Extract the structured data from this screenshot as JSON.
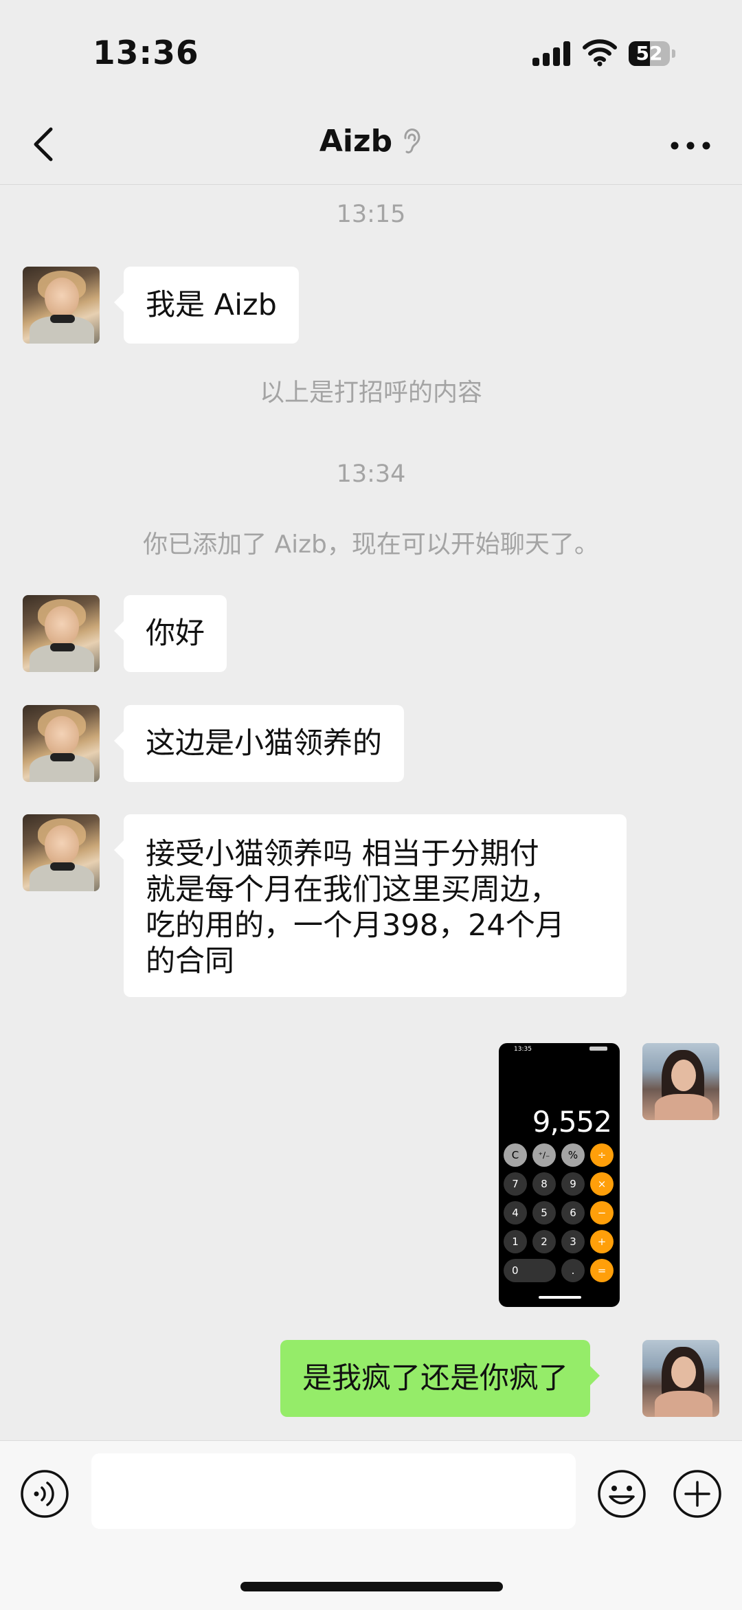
{
  "status_bar": {
    "time": "13:36",
    "battery": "52",
    "battery_level": 0.52
  },
  "header": {
    "title": "Aizb",
    "back_icon": "chevron-left-icon",
    "ear_icon": "ear-icon",
    "more_icon": "ellipsis-icon"
  },
  "messages": {
    "time1": "13:15",
    "m1": "我是 Aizb",
    "greet_note": "以上是打招呼的内容",
    "time2": "13:34",
    "added_note": "你已添加了 Aizb，现在可以开始聊天了。",
    "m2": "你好",
    "m3": "这边是小猫领养的",
    "m4_lines": [
      "接受小猫领养吗 相当于分期付",
      "就是每个月在我们这里买周边，",
      "吃的用的，一个月398，24个月",
      "的合同"
    ],
    "photo": {
      "status_time": "13:35",
      "display": "9,552",
      "keys": [
        [
          "C",
          "⁺∕₋",
          "%",
          "÷"
        ],
        [
          "7",
          "8",
          "9",
          "×"
        ],
        [
          "4",
          "5",
          "6",
          "−"
        ],
        [
          "1",
          "2",
          "3",
          "+"
        ],
        [
          "0",
          ".",
          "="
        ]
      ]
    },
    "m5": "是我疯了还是你疯了"
  },
  "input_bar": {
    "placeholder": "",
    "voice_icon": "voice-icon",
    "emoji_icon": "emoji-icon",
    "plus_icon": "plus-icon"
  },
  "colors": {
    "background": "#ededed",
    "bubble_in": "#ffffff",
    "bubble_out": "#95ec69",
    "calc_orange": "#ff9f0a"
  }
}
